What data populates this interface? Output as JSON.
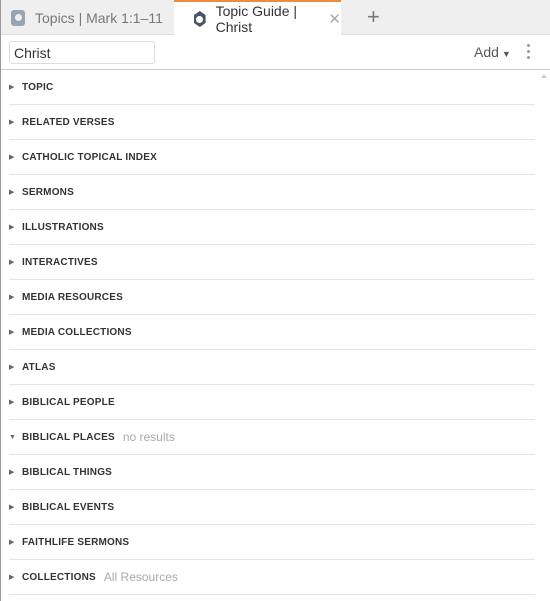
{
  "tabs": [
    {
      "label": "Topics | Mark 1:1–11",
      "active": false
    },
    {
      "label": "Topic Guide | Christ",
      "active": true
    }
  ],
  "toolbar": {
    "search_value": "Christ",
    "add_label": "Add"
  },
  "sections": [
    {
      "label": "TOPIC",
      "expanded": false,
      "note": ""
    },
    {
      "label": "RELATED VERSES",
      "expanded": false,
      "note": ""
    },
    {
      "label": "CATHOLIC TOPICAL INDEX",
      "expanded": false,
      "note": ""
    },
    {
      "label": "SERMONS",
      "expanded": false,
      "note": ""
    },
    {
      "label": "ILLUSTRATIONS",
      "expanded": false,
      "note": ""
    },
    {
      "label": "INTERACTIVES",
      "expanded": false,
      "note": ""
    },
    {
      "label": "MEDIA RESOURCES",
      "expanded": false,
      "note": ""
    },
    {
      "label": "MEDIA COLLECTIONS",
      "expanded": false,
      "note": ""
    },
    {
      "label": "ATLAS",
      "expanded": false,
      "note": ""
    },
    {
      "label": "BIBLICAL PEOPLE",
      "expanded": false,
      "note": ""
    },
    {
      "label": "BIBLICAL PLACES",
      "expanded": true,
      "note": "no results"
    },
    {
      "label": "BIBLICAL THINGS",
      "expanded": false,
      "note": ""
    },
    {
      "label": "BIBLICAL EVENTS",
      "expanded": false,
      "note": ""
    },
    {
      "label": "FAITHLIFE SERMONS",
      "expanded": false,
      "note": ""
    },
    {
      "label": "COLLECTIONS",
      "expanded": false,
      "note": "All Resources"
    }
  ],
  "colors": {
    "active_tab_accent": "#f08a3c"
  }
}
